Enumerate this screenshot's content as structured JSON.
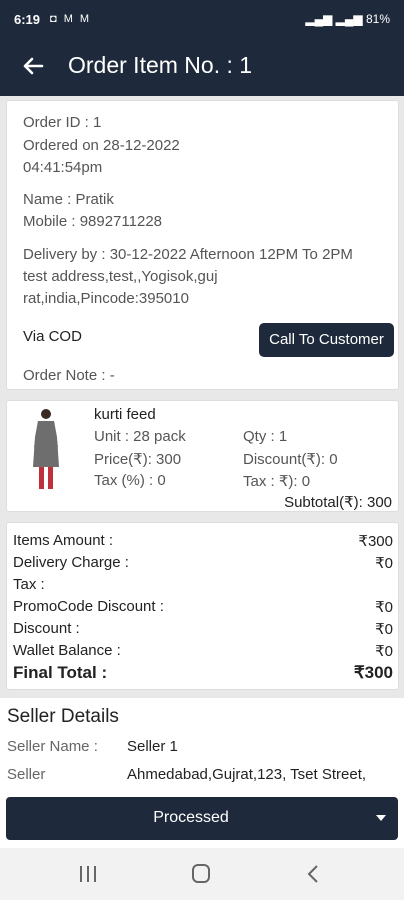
{
  "status_bar": {
    "time": "6:19",
    "left_icons": "◘ M M",
    "right_text": "81%"
  },
  "app_bar": {
    "title": "Order Item No. : 1"
  },
  "order": {
    "order_id": "Order ID : 1",
    "ordered_on_line1": "Ordered on 28-12-2022",
    "ordered_on_line2": "04:41:54pm",
    "name": "Name : Pratik",
    "mobile": "Mobile : 9892711228",
    "delivery_line1": "Delivery by : 30-12-2022 Afternoon 12PM To 2PM",
    "address_line1": "test address,test,,Yogisok,guj",
    "address_line2": "rat,india,Pincode:395010",
    "payment": "Via COD",
    "call_button": "Call To Customer",
    "note": "Order Note : -"
  },
  "item": {
    "name": "kurti feed",
    "unit": "Unit : 28 pack",
    "qty": "Qty : 1",
    "price": "Price(₹): 300",
    "discount": "Discount(₹): 0",
    "tax_pct": "Tax (%) : 0",
    "tax_amt": "Tax : ₹): 0",
    "subtotal": "Subtotal(₹): 300"
  },
  "amounts": {
    "items_amount_label": "Items Amount :",
    "items_amount_value": "₹300",
    "delivery_label": "Delivery Charge :",
    "delivery_value": "₹0",
    "tax_label": "Tax :",
    "promo_label": "PromoCode Discount :",
    "promo_value": "₹0",
    "discount_label": "Discount :",
    "discount_value": "₹0",
    "wallet_label": "Wallet Balance :",
    "wallet_value": "₹0",
    "final_label": "Final Total :",
    "final_value": "₹300"
  },
  "seller": {
    "title": "Seller Details",
    "name_label": "Seller Name :",
    "name_value": "Seller 1",
    "address_label": "Seller",
    "address_value": "Ahmedabad,Gujrat,123, Tset Street,"
  },
  "status_select": {
    "value": "Processed"
  },
  "colors": {
    "primary": "#1e2a3b",
    "background": "#e8e8e8"
  }
}
